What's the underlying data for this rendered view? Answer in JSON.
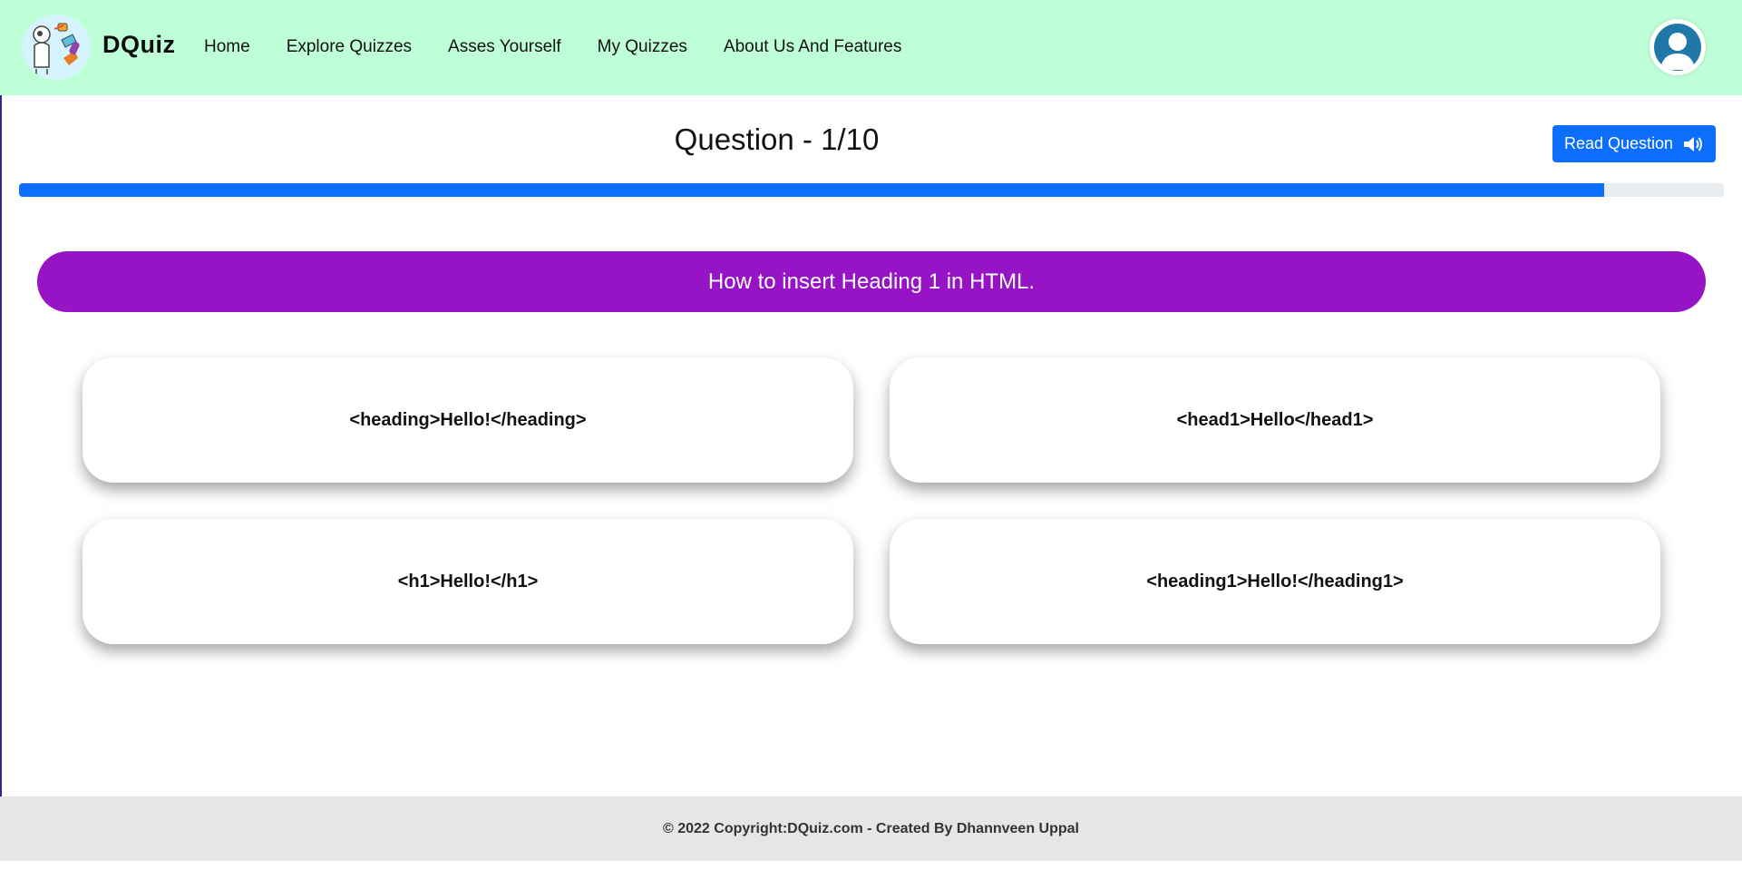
{
  "brand": {
    "name": "DQuiz"
  },
  "nav": {
    "items": [
      {
        "label": "Home"
      },
      {
        "label": "Explore Quizzes"
      },
      {
        "label": "Asses Yourself"
      },
      {
        "label": "My Quizzes"
      },
      {
        "label": "About Us And Features"
      }
    ]
  },
  "question": {
    "title": "Question - 1/10",
    "text": "How to insert Heading 1 in HTML.",
    "read_button_label": "Read Question",
    "progress_fraction": 0.93
  },
  "options": [
    {
      "label": "<heading>Hello!</heading>"
    },
    {
      "label": "<head1>Hello</head1>"
    },
    {
      "label": "<h1>Hello!</h1>"
    },
    {
      "label": "<heading1>Hello!</heading1>"
    }
  ],
  "footer": {
    "text": "© 2022 Copyright:DQuiz.com - Created By Dhannveen Uppal"
  },
  "colors": {
    "navbar_bg": "#bfffd7",
    "accent_blue": "#0d6efd",
    "question_banner": "#9614c6",
    "footer_bg": "#e6e6e6"
  },
  "icons": {
    "logo": "robot-scientist-logo",
    "avatar": "user-avatar-icon",
    "read": "speaker-volume-icon"
  }
}
